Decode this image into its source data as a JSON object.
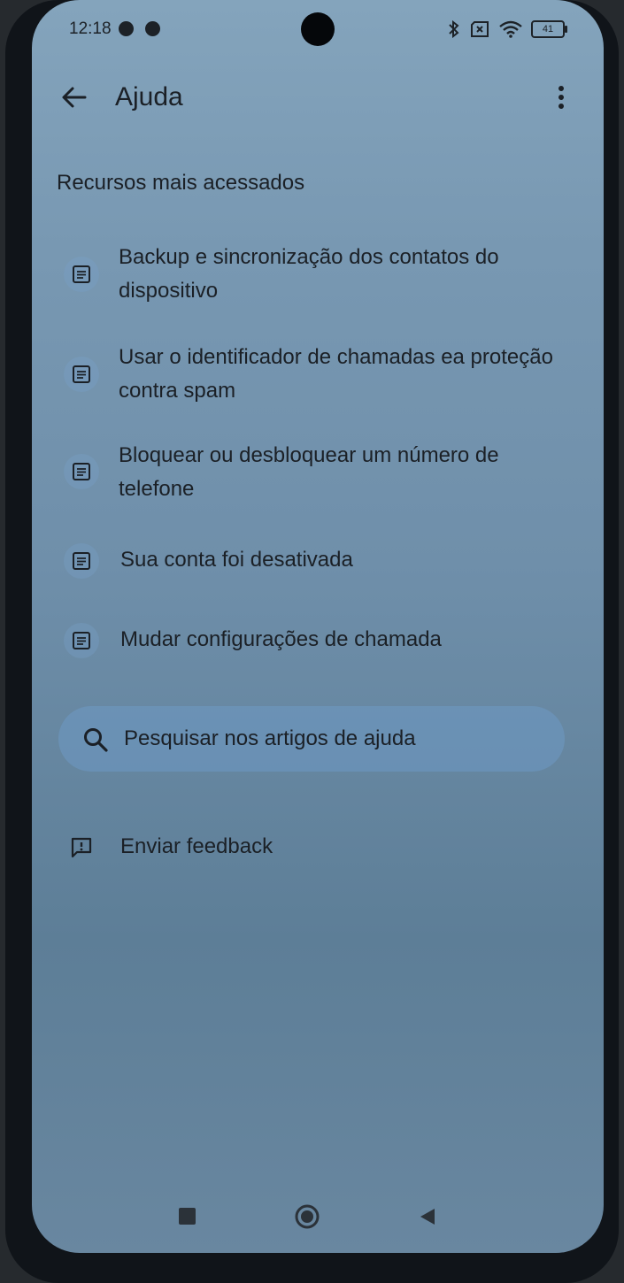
{
  "status_bar": {
    "time": "12:18",
    "battery": "41"
  },
  "app_bar": {
    "title": "Ajuda"
  },
  "section": {
    "title": "Recursos mais acessados"
  },
  "articles": [
    {
      "label": "Backup e sincronização dos contatos do dispositivo",
      "icon": "article-icon"
    },
    {
      "label": "Usar o identificador de chamadas ea proteção contra spam",
      "icon": "article-icon"
    },
    {
      "label": "Bloquear ou desbloquear um número de telefone",
      "icon": "article-icon"
    },
    {
      "label": "Sua conta foi desativada",
      "icon": "article-icon"
    },
    {
      "label": "Mudar configurações de chamada",
      "icon": "article-icon"
    }
  ],
  "search": {
    "placeholder": "Pesquisar nos artigos de ajuda",
    "icon": "search-icon"
  },
  "feedback": {
    "label": "Enviar feedback",
    "icon": "feedback-icon"
  },
  "colors": {
    "text": "#1b2026",
    "pill": "#6e9ecd"
  }
}
